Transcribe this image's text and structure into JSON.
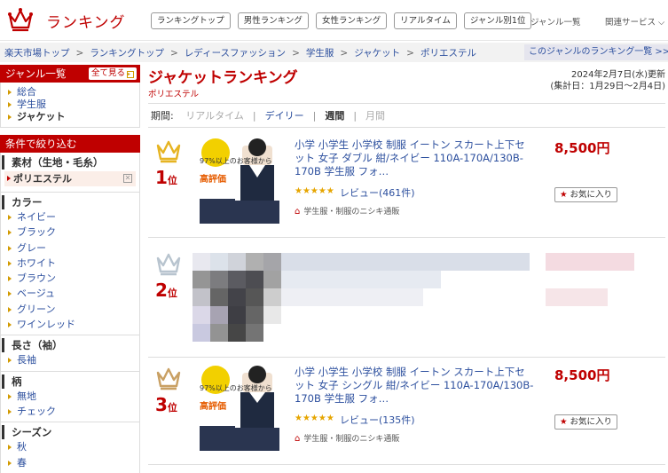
{
  "header": {
    "logo_text": "ランキング",
    "nav": [
      "ランキングトップ",
      "男性ランキング",
      "女性ランキング",
      "リアルタイム",
      "ジャンル別1位"
    ],
    "genre_list": "ジャンル一覧",
    "related": "関連サービス"
  },
  "breadcrumb": [
    "楽天市場トップ",
    "ランキングトップ",
    "レディースファッション",
    "学生服",
    "ジャケット",
    "ポリエステル"
  ],
  "cross_link": "このジャンルのランキング一覧 >>",
  "sidebar": {
    "genre_title": "ジャンル一覧",
    "see_all": "全て見る",
    "genres": [
      {
        "label": "総合",
        "current": false
      },
      {
        "label": "学生服",
        "current": false
      },
      {
        "label": "ジャケット",
        "current": true
      }
    ],
    "filter_title": "条件で絞り込む",
    "groups": [
      {
        "title": "素材（生地・毛糸）",
        "selected": "ポリエステル",
        "items": []
      },
      {
        "title": "カラー",
        "items": [
          "ネイビー",
          "ブラック",
          "グレー",
          "ホワイト",
          "ブラウン",
          "ベージュ",
          "グリーン",
          "ワインレッド"
        ]
      },
      {
        "title": "長さ（袖）",
        "items": [
          "長袖"
        ]
      },
      {
        "title": "柄",
        "items": [
          "無地",
          "チェック"
        ]
      },
      {
        "title": "シーズン",
        "items": [
          "秋",
          "春"
        ]
      }
    ]
  },
  "main": {
    "title": "ジャケットランキング",
    "subtitle": "ポリエステル",
    "updated": "2024年2月7日(水)更新",
    "period_range": "(集計日：1月29日〜2月4日)",
    "period_label": "期間:",
    "periods": [
      {
        "label": "リアルタイム",
        "active": false
      },
      {
        "label": "デイリー",
        "active": false
      },
      {
        "label": "週間",
        "active": true
      },
      {
        "label": "月間",
        "active": false
      }
    ],
    "items": [
      {
        "rank": "1",
        "rank_suffix": "位",
        "crown_color": "#e6b422",
        "title": "小学 小学生 小学校 制服 イートン スカート上下セット 女子 ダブル 紺/ネイビー 110A-170A/130B-170B 学生服 フォ…",
        "price": "8,500円",
        "stars": "★★★★★",
        "review": "レビュー(461件)",
        "shop": "学生服・制服のニシキ通販",
        "fav": "お気に入り",
        "blurred": false,
        "thumb_badge": "97%以上のお客様から",
        "thumb_label": "高評価"
      },
      {
        "rank": "2",
        "rank_suffix": "位",
        "crown_color": "#b8c4cf",
        "blurred": true
      },
      {
        "rank": "3",
        "rank_suffix": "位",
        "crown_color": "#c9a063",
        "title": "小学 小学生 小学校 制服 イートン スカート上下セット 女子 シングル 紺/ネイビー 110A-170A/130B-170B 学生服 フォ…",
        "price": "8,500円",
        "stars": "★★★★★",
        "review": "レビュー(135件)",
        "shop": "学生服・制服のニシキ通販",
        "fav": "お気に入り",
        "blurred": false,
        "thumb_badge": "97%以上のお客様から",
        "thumb_label": "高評価"
      }
    ]
  }
}
